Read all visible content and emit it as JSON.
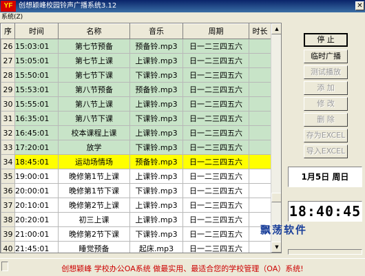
{
  "window": {
    "icon_text": "YF",
    "title": "创想颖峰校园铃声广播系统3.12",
    "close_symbol": "✕"
  },
  "menu": {
    "system_label": "系统(Z)"
  },
  "table": {
    "columns": [
      "序",
      "时间",
      "名称",
      "音乐",
      "周期",
      "时长"
    ],
    "rows": [
      {
        "seq": "26",
        "time": "15:03:01",
        "name": "第七节预备",
        "music": "预备铃.mp3",
        "period": "日一二三四五六",
        "duration": "",
        "status": "green"
      },
      {
        "seq": "27",
        "time": "15:05:01",
        "name": "第七节上课",
        "music": "上课铃.mp3",
        "period": "日一二三四五六",
        "duration": "",
        "status": "green"
      },
      {
        "seq": "28",
        "time": "15:50:01",
        "name": "第七节下课",
        "music": "下课铃.mp3",
        "period": "日一二三四五六",
        "duration": "",
        "status": "green"
      },
      {
        "seq": "29",
        "time": "15:53:01",
        "name": "第八节预备",
        "music": "预备铃.mp3",
        "period": "日一二三四五六",
        "duration": "",
        "status": "green"
      },
      {
        "seq": "30",
        "time": "15:55:01",
        "name": "第八节上课",
        "music": "上课铃.mp3",
        "period": "日一二三四五六",
        "duration": "",
        "status": "green"
      },
      {
        "seq": "31",
        "time": "16:35:01",
        "name": "第八节下课",
        "music": "下课铃.mp3",
        "period": "日一二三四五六",
        "duration": "",
        "status": "green"
      },
      {
        "seq": "32",
        "time": "16:45:01",
        "name": "校本课程上课",
        "music": "上课铃.mp3",
        "period": "日一二三四五六",
        "duration": "",
        "status": "green"
      },
      {
        "seq": "33",
        "time": "17:20:01",
        "name": "放学",
        "music": "下课铃.mp3",
        "period": "日一二三四五六",
        "duration": "",
        "status": "green"
      },
      {
        "seq": "34",
        "time": "18:45:01",
        "name": "运动场情场",
        "music": "预备铃.mp3",
        "period": "日一二三四五六",
        "duration": "",
        "status": "yellow"
      },
      {
        "seq": "35",
        "time": "19:00:01",
        "name": "晚修第1节上课",
        "music": "上课铃.mp3",
        "period": "日一二三四五六",
        "duration": "",
        "status": "white"
      },
      {
        "seq": "36",
        "time": "20:00:01",
        "name": "晚修第1节下课",
        "music": "下课铃.mp3",
        "period": "日一二三四五六",
        "duration": "",
        "status": "white"
      },
      {
        "seq": "37",
        "time": "20:10:01",
        "name": "晚修第2节上课",
        "music": "上课铃.mp3",
        "period": "日一二三四五六",
        "duration": "",
        "status": "white"
      },
      {
        "seq": "38",
        "time": "20:20:01",
        "name": "初三上课",
        "music": "上课铃.mp3",
        "period": "日一二三四五六",
        "duration": "",
        "status": "white"
      },
      {
        "seq": "39",
        "time": "21:00:01",
        "name": "晚修第2节下课",
        "music": "下课铃.mp3",
        "period": "日一二三四五六",
        "duration": "",
        "status": "white"
      },
      {
        "seq": "40",
        "time": "21:45:01",
        "name": "睡觉预备",
        "music": "起床.mp3",
        "period": "日一二三四五六",
        "duration": "",
        "status": "white"
      }
    ]
  },
  "buttons": {
    "stop": "停  止",
    "temp_broadcast": "临时广播",
    "test_play": "测试播放",
    "add": "添  加",
    "modify": "修  改",
    "delete": "删  除",
    "save_excel": "存为EXCEL",
    "import_excel": "导入EXCEL"
  },
  "date_display": "1月5日  周日",
  "clock_display": "18:40:45",
  "watermark": "飘荡软件",
  "status_bar": "创想颖峰  学校办公OA系统  做最实用、最适合您的学校管理（OA）系统!",
  "colors": {
    "row_green": "#c8e4c8",
    "row_yellow": "#ffff00",
    "status_text": "#cc0000",
    "title_bar": "#0a246a"
  }
}
